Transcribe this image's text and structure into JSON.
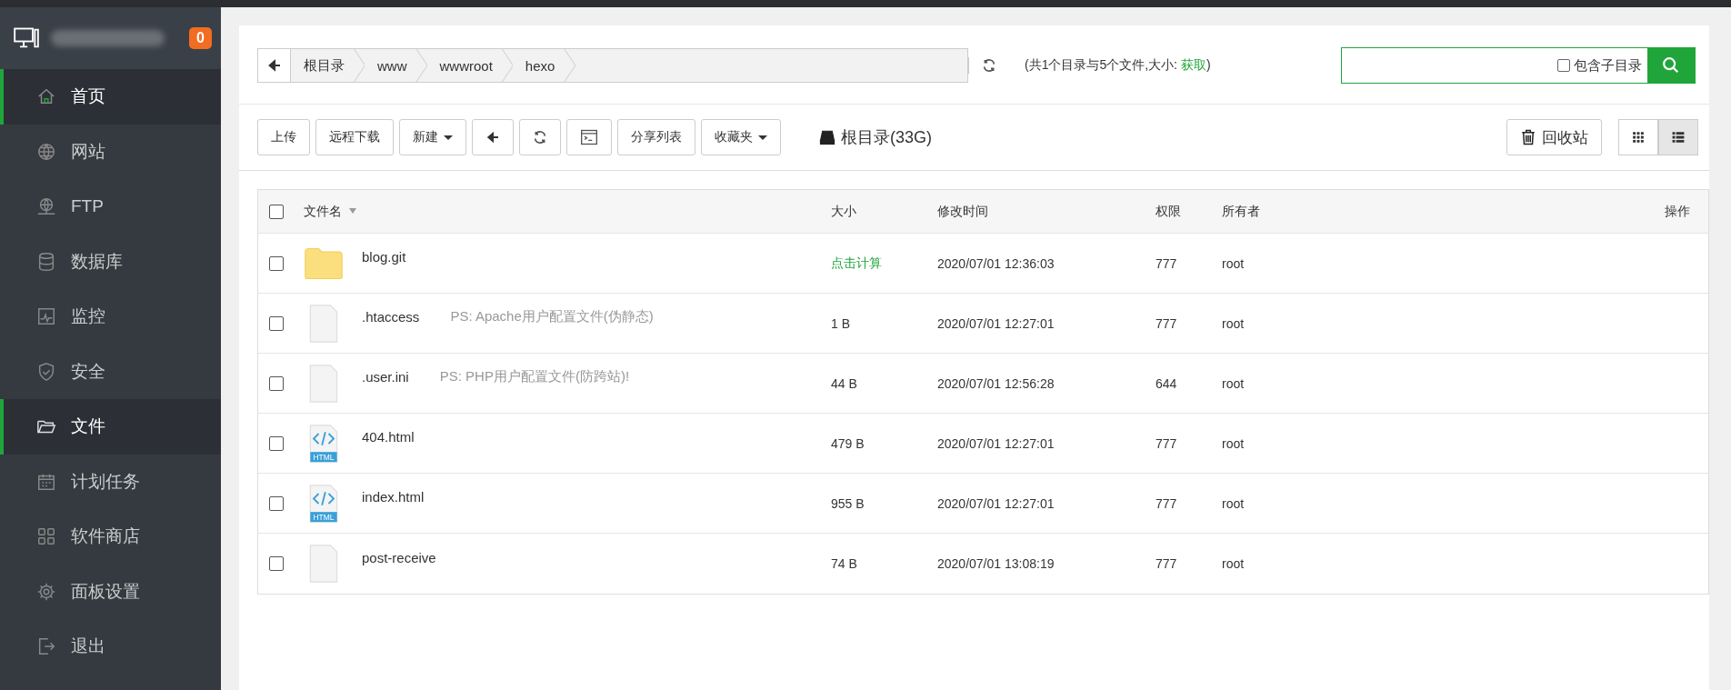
{
  "sidebar": {
    "badge": "0",
    "items": [
      {
        "label": "首页",
        "selected": true
      },
      {
        "label": "网站",
        "selected": false
      },
      {
        "label": "FTP",
        "selected": false
      },
      {
        "label": "数据库",
        "selected": false
      },
      {
        "label": "监控",
        "selected": false
      },
      {
        "label": "安全",
        "selected": false
      },
      {
        "label": "文件",
        "selected": true
      },
      {
        "label": "计划任务",
        "selected": false
      },
      {
        "label": "软件商店",
        "selected": false
      },
      {
        "label": "面板设置",
        "selected": false
      },
      {
        "label": "退出",
        "selected": false
      }
    ]
  },
  "breadcrumb": [
    "根目录",
    "www",
    "wwwroot",
    "hexo"
  ],
  "summary": {
    "text": "(共1个目录与5个文件,大小: ",
    "link": "获取",
    "end": ")"
  },
  "search": {
    "subdir_label": "包含子目录",
    "subdir_checked": false
  },
  "toolbar": [
    {
      "kind": "text",
      "label": "上传"
    },
    {
      "kind": "text",
      "label": "远程下载"
    },
    {
      "kind": "dropdown",
      "label": "新建"
    },
    {
      "kind": "back"
    },
    {
      "kind": "refresh"
    },
    {
      "kind": "terminal"
    },
    {
      "kind": "text",
      "label": "分享列表"
    },
    {
      "kind": "dropdown",
      "label": "收藏夹"
    }
  ],
  "disk": "根目录(33G)",
  "recycle": "回收站",
  "view": [
    {
      "kind": "grid",
      "selected": false
    },
    {
      "kind": "list",
      "selected": true
    }
  ],
  "table": {
    "select_all_checked": false,
    "columns": [
      "文件名",
      "大小",
      "修改时间",
      "权限",
      "所有者",
      "操作"
    ],
    "rows": [
      {
        "kind": "folder",
        "checked": false,
        "name": "blog.git",
        "size": "点击计算",
        "size_link": true,
        "time": "2020/07/01 12:36:03",
        "perm": "777",
        "owner": "root"
      },
      {
        "kind": "file",
        "checked": false,
        "name": ".htaccess",
        "note": "PS: Apache用户配置文件(伪静态)",
        "size": "1 B",
        "size_link": false,
        "time": "2020/07/01 12:27:01",
        "perm": "777",
        "owner": "root"
      },
      {
        "kind": "file",
        "checked": false,
        "name": ".user.ini",
        "note": "PS: PHP用户配置文件(防跨站)!",
        "size": "44 B",
        "size_link": false,
        "time": "2020/07/01 12:56:28",
        "perm": "644",
        "owner": "root"
      },
      {
        "kind": "html",
        "checked": false,
        "icon_text": "HTML",
        "name": "404.html",
        "size": "479 B",
        "size_link": false,
        "time": "2020/07/01 12:27:01",
        "perm": "777",
        "owner": "root"
      },
      {
        "kind": "html",
        "checked": false,
        "icon_text": "HTML",
        "name": "index.html",
        "size": "955 B",
        "size_link": false,
        "time": "2020/07/01 12:27:01",
        "perm": "777",
        "owner": "root"
      },
      {
        "kind": "file",
        "checked": false,
        "name": "post-receive",
        "size": "74 B",
        "size_link": false,
        "time": "2020/07/01 13:08:19",
        "perm": "777",
        "owner": "root"
      }
    ]
  }
}
